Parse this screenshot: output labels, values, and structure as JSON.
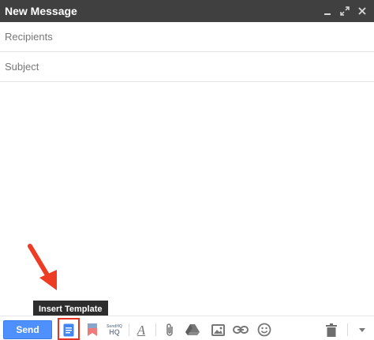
{
  "window": {
    "title": "New Message"
  },
  "fields": {
    "recipients_placeholder": "Recipients",
    "subject_placeholder": "Subject"
  },
  "tooltip": {
    "text": "Insert Template"
  },
  "toolbar": {
    "send_label": "Send",
    "hq_label_top": "SendHQ",
    "hq_label_bottom": "HQ",
    "format_label": "A",
    "icons": [
      "insert-template-icon",
      "bookmark-icon",
      "sendhq-icon",
      "formatting-icon",
      "attach-icon",
      "drive-icon",
      "photo-icon",
      "link-icon",
      "emoji-icon",
      "trash-icon",
      "more-options-icon"
    ]
  },
  "colors": {
    "titlebar": "#404040",
    "send_button": "#4d90fe",
    "highlight": "#e53424",
    "template_icon": "#4285f4"
  }
}
